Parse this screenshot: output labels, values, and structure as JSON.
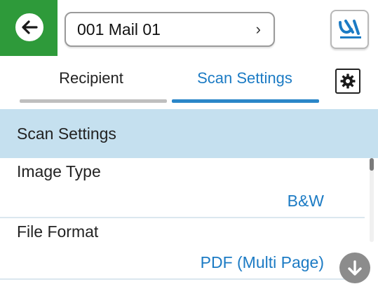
{
  "header": {
    "destination": "001 Mail 01",
    "destination_chevron": "›",
    "back_icon": "back-arrow-icon",
    "logo_icon": "scanner-logo-icon"
  },
  "tabs": [
    {
      "label": "Recipient",
      "active": false
    },
    {
      "label": "Scan Settings",
      "active": true
    }
  ],
  "section": {
    "title": "Scan Settings"
  },
  "settings": [
    {
      "label": "Image Type",
      "value": "B&W"
    },
    {
      "label": "File Format",
      "value": "PDF (Multi Page)"
    }
  ],
  "colors": {
    "accent": "#1c7bc4",
    "header_green": "#2e9a3a",
    "section_bg": "#c5e0ef"
  }
}
